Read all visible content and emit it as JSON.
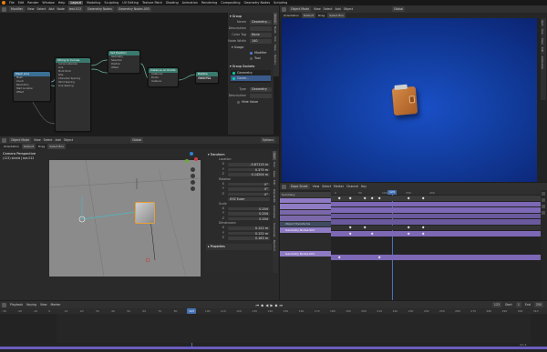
{
  "topbar": {
    "menus": [
      "File",
      "Edit",
      "Render",
      "Window",
      "Help"
    ],
    "workspace_tabs": [
      "Layout",
      "Modeling",
      "Sculpting",
      "UV Editing",
      "Texture Paint",
      "Shading",
      "Animation",
      "Rendering",
      "Compositing",
      "Geometry Nodes",
      "Scripting"
    ],
    "active_tab": "Layout",
    "file_tabs": [
      "test.013",
      "Geometry Nodes",
      "Geometry Nodes.003"
    ]
  },
  "node_editor": {
    "header_items": [
      "Modifier",
      "View",
      "Select",
      "Add",
      "Node"
    ],
    "nodes": [
      {
        "title": "Mesh Line",
        "color": "#3a6f94",
        "rows": [
          "Mesh",
          "Count",
          "Resolution",
          "Start Location",
          "Offset"
        ]
      },
      {
        "title": "String to Curves",
        "color": "#3a7a6e",
        "rows": [
          "Curve Instances",
          "Line",
          "Pivot Point",
          "Size",
          "Character Spacing",
          "Word Spacing",
          "Line Spacing"
        ]
      },
      {
        "title": "Set Position",
        "color": "#3a7a6e",
        "rows": [
          "Geometry",
          "Selection",
          "Position",
          "Offset"
        ]
      },
      {
        "title": "Instance on Points",
        "color": "#3a7a6e",
        "rows": [
          "Instances",
          "Points",
          "Instance"
        ]
      },
      {
        "title": "Realize Instances",
        "color": "#3a7a6e",
        "rows": [
          "Geometry",
          "Geometry"
        ]
      },
      {
        "title": "Group Output",
        "color": "#4a4a4a",
        "rows": [
          "Geometry"
        ]
      }
    ],
    "side_panel": {
      "title": "Group",
      "fields": [
        {
          "label": "Name",
          "value": "Geometry..."
        },
        {
          "label": "Description",
          "value": ""
        },
        {
          "label": "Color Tag",
          "value": "None"
        },
        {
          "label": "Node Width",
          "value": "140"
        }
      ],
      "usage_label": "Usage",
      "usage_options": [
        "Modifier",
        "Tool"
      ],
      "sockets_title": "Group Sockets",
      "socket_items": [
        "Geometry",
        "Geom..."
      ],
      "type_label": "Type",
      "type_value": "Geometry",
      "desc_label": "Description",
      "hide_value": "Hide Value"
    },
    "vtabs": [
      "Group",
      "Node",
      "Tool",
      "View",
      "Options"
    ]
  },
  "camera_view": {
    "header_items": [
      "Object Mode",
      "View",
      "Select",
      "Add",
      "Object"
    ],
    "orientation": "Global",
    "sub_items": [
      "Orientation",
      "Default",
      "Drag",
      "Select Box"
    ],
    "colors": {
      "bg_top": "#0b1f6e",
      "bg_bottom": "#1545b8",
      "wallet": "#c06a2a"
    },
    "vtabs": [
      "Item",
      "Tool",
      "View",
      "Edit",
      "Animation",
      "BlenderKit"
    ]
  },
  "viewport3d": {
    "header_items": [
      "Object Mode",
      "View",
      "Select",
      "Add",
      "Object"
    ],
    "orientation": "Global",
    "options_label": "Options",
    "sub_items": [
      "Orientation",
      "Default",
      "Drag",
      "Select Box"
    ],
    "overlay_title": "Camera Perspective",
    "overlay_sub": "(123) shield | bot.012",
    "transform": {
      "title": "Transform",
      "location_label": "Location",
      "location": [
        "-0.87115 m",
        "0.375 m",
        "0.14204 m"
      ],
      "rotation_label": "Rotation",
      "rotation": [
        "0°",
        "0°",
        "0°"
      ],
      "rotation_mode": "XYZ Euler",
      "scale_label": "Scale",
      "scale": [
        "0.204",
        "0.204",
        "0.204"
      ],
      "dimensions_label": "Dimensions",
      "dimensions": [
        "0.122 m",
        "0.122 m",
        "0.163 m"
      ],
      "axis": [
        "X",
        "Y",
        "Z"
      ]
    },
    "properties_label": "Properties",
    "vtabs": [
      "Item",
      "Tool",
      "View",
      "Edit",
      "BlenderKit",
      "Animation",
      "Screencast",
      "Machin3"
    ]
  },
  "dopesheet": {
    "header_items": [
      "Dope Sheet",
      "View",
      "Select",
      "Marker",
      "Channel",
      "Key"
    ],
    "summary_label": "Summary",
    "channels": [
      "Object Transforms",
      "Geometry Nodes.003",
      "Geometry Nodes.003"
    ],
    "ruler": [
      "0",
      "50",
      "100",
      "150",
      "200"
    ],
    "current_frame": "123"
  },
  "timeline": {
    "header_items": [
      "Playback",
      "Keying",
      "View",
      "Marker"
    ],
    "current_frame": "123",
    "start_label": "Start",
    "start": "1",
    "end_label": "End",
    "end": "250",
    "ruler": [
      "-30",
      "-20",
      "-10",
      "0",
      "10",
      "20",
      "30",
      "40",
      "50",
      "60",
      "70",
      "80",
      "90",
      "100",
      "110",
      "120",
      "130",
      "140",
      "150",
      "160",
      "170",
      "180",
      "190",
      "200",
      "210",
      "220",
      "230",
      "240",
      "250",
      "260",
      "270",
      "280",
      "290",
      "300",
      "310"
    ],
    "status_right": "4.1.1"
  }
}
